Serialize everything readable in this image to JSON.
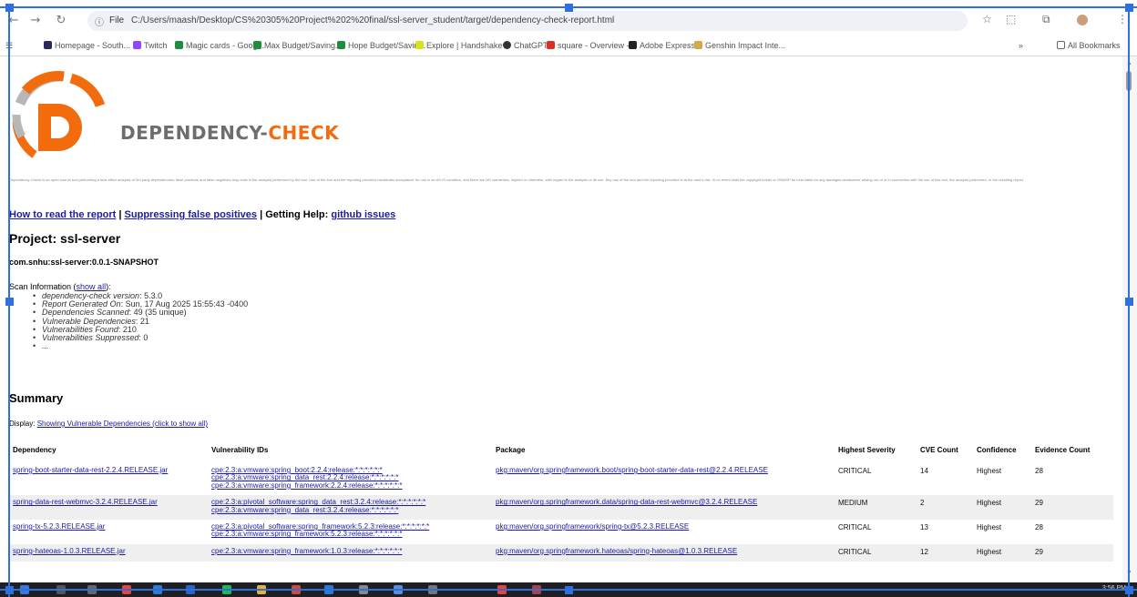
{
  "browser": {
    "url_scheme": "File",
    "url": "C:/Users/maash/Desktop/CS%20305%20Project%202%20final/ssl-server_student/target/dependency-check-report.html",
    "bookmarks": [
      "Homepage - South...",
      "Twitch",
      "Magic cards - Goog...",
      "Max Budget/Saving...",
      "Hope Budget/Savin...",
      "Explore | Handshake",
      "ChatGPT",
      "square - Overview -...",
      "Adobe Express",
      "Genshin Impact Inte...",
      "All Bookmarks"
    ],
    "more_bookmarks": "»"
  },
  "report": {
    "logo_word1": "DEPENDENCY-",
    "logo_word2": "CHECK",
    "disclaimer": "Dependency-Check is an open source tool performing a best effort analysis of 3rd party dependencies; false positives and false negatives may exist in the analysis performed by the tool. Use of the tool and the reporting provided constitutes acceptance for use in an AS IS condition, and there are NO warranties, implied or otherwise, with regard to the analysis or its use. Any use of the tool and the reporting provided is at the user's risk. In no event shall the copyright holder or OWASP be held liable for any damages whatsoever arising out of or in connection with the use of this tool, the analysis performed, or the resulting report.",
    "help_links": {
      "how_to_read": "How to read the report",
      "sep1": " | ",
      "suppressing": "Suppressing false positives",
      "sep2": " | Getting Help: ",
      "github": "github issues"
    },
    "project_title": "Project: ssl-server",
    "gav": "com.snhu:ssl-server:0.0.1-SNAPSHOT",
    "scan_info_label": "Scan Information (",
    "scan_info_link": "show all",
    "scan_info_end": "):",
    "scan_items": [
      {
        "label": "dependency-check version",
        "value": ": 5.3.0"
      },
      {
        "label": "Report Generated On",
        "value": ": Sun, 17 Aug 2025 15:55:43 -0400"
      },
      {
        "label": "Dependencies Scanned",
        "value": ": 49 (35 unique)"
      },
      {
        "label": "Vulnerable Dependencies",
        "value": ": 21"
      },
      {
        "label": "Vulnerabilities Found",
        "value": ": 210"
      },
      {
        "label": "Vulnerabilities Suppressed",
        "value": ": 0"
      },
      {
        "label": "...",
        "value": ""
      }
    ],
    "summary_title": "Summary",
    "display_label": "Display: ",
    "display_link": "Showing Vulnerable Dependencies (click to show all)",
    "table": {
      "headers": [
        "Dependency",
        "Vulnerability IDs",
        "Package",
        "Highest Severity",
        "CVE Count",
        "Confidence",
        "Evidence Count"
      ],
      "rows": [
        {
          "dependency": "spring-boot-starter-data-rest-2.2.4.RELEASE.jar",
          "vuln_ids": [
            "cpe:2.3:a:vmware:spring_boot:2.2.4:release:*:*:*:*:*:*",
            "cpe:2.3:a:vmware:spring_data_rest:2.2.4:release:*:*:*:*:*:*",
            "cpe:2.3:a:vmware:spring_framework:2.2.4:release:*:*:*:*:*:*"
          ],
          "package": "pkg:maven/org.springframework.boot/spring-boot-starter-data-rest@2.2.4.RELEASE",
          "severity": "CRITICAL",
          "cve_count": "14",
          "confidence": "Highest",
          "evidence": "28"
        },
        {
          "dependency": "spring-data-rest-webmvc-3.2.4.RELEASE.jar",
          "vuln_ids": [
            "cpe:2.3:a:pivotal_software:spring_data_rest:3.2.4:release:*:*:*:*:*:*",
            "cpe:2.3:a:vmware:spring_data_rest:3.2.4:release:*:*:*:*:*:*"
          ],
          "package": "pkg:maven/org.springframework.data/spring-data-rest-webmvc@3.2.4.RELEASE",
          "severity": "MEDIUM",
          "cve_count": "2",
          "confidence": "Highest",
          "evidence": "29"
        },
        {
          "dependency": "spring-tx-5.2.3.RELEASE.jar",
          "vuln_ids": [
            "cpe:2.3:a:pivotal_software:spring_framework:5.2.3:release:*:*:*:*:*:*",
            "cpe:2.3:a:vmware:spring_framework:5.2.3:release:*:*:*:*:*:*"
          ],
          "package": "pkg:maven/org.springframework/spring-tx@5.2.3.RELEASE",
          "severity": "CRITICAL",
          "cve_count": "13",
          "confidence": "Highest",
          "evidence": "28"
        },
        {
          "dependency": "spring-hateoas-1.0.3.RELEASE.jar",
          "vuln_ids": [
            "cpe:2.3:a:vmware:spring_framework:1.0.3:release:*:*:*:*:*:*"
          ],
          "package": "pkg:maven/org.springframework.hateoas/spring-hateoas@1.0.3.RELEASE",
          "severity": "CRITICAL",
          "cve_count": "12",
          "confidence": "Highest",
          "evidence": "29"
        }
      ]
    }
  },
  "taskbar": {
    "clock": "3:56 PM"
  },
  "colors": {
    "accent_orange": "#f26c0d",
    "logo_gray": "#6d6d6d",
    "link_blue": "#1a1aa6",
    "selection_blue": "#2f6fde"
  }
}
